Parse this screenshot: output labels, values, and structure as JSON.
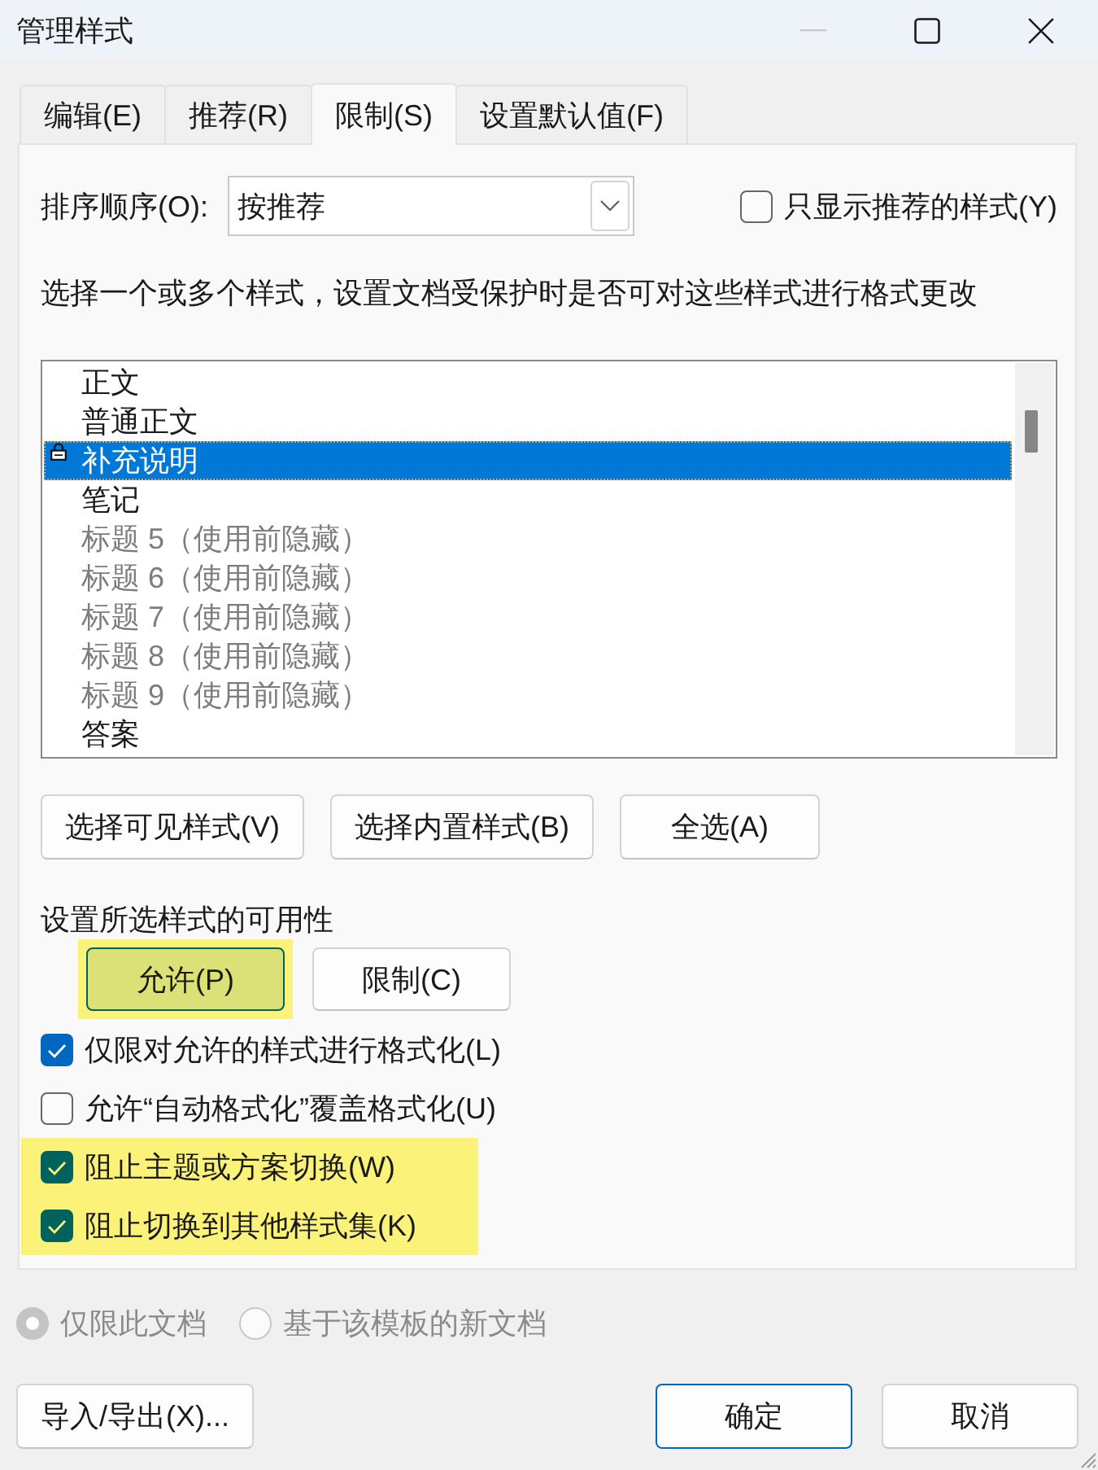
{
  "window": {
    "title": "管理样式",
    "minimize_disabled": true
  },
  "tabs": [
    {
      "label": "编辑(E)",
      "selected": false
    },
    {
      "label": "推荐(R)",
      "selected": false
    },
    {
      "label": "限制(S)",
      "selected": true
    },
    {
      "label": "设置默认值(F)",
      "selected": false
    }
  ],
  "sort": {
    "label": "排序顺序(O):",
    "value": "按推荐",
    "recommended_only": {
      "label": "只显示推荐的样式(Y)",
      "checked": false
    }
  },
  "instructions": "选择一个或多个样式，设置文档受保护时是否可对这些样式进行格式更改",
  "styles": [
    {
      "name": "正文",
      "selected": false,
      "locked": false,
      "greyed": false
    },
    {
      "name": "普通正文",
      "selected": false,
      "locked": false,
      "greyed": false
    },
    {
      "name": "补充说明",
      "selected": true,
      "locked": true,
      "greyed": false
    },
    {
      "name": "笔记",
      "selected": false,
      "locked": false,
      "greyed": false
    },
    {
      "name": "标题 5（使用前隐藏）",
      "selected": false,
      "locked": false,
      "greyed": true
    },
    {
      "name": "标题 6（使用前隐藏）",
      "selected": false,
      "locked": false,
      "greyed": true
    },
    {
      "name": "标题 7（使用前隐藏）",
      "selected": false,
      "locked": false,
      "greyed": true
    },
    {
      "name": "标题 8（使用前隐藏）",
      "selected": false,
      "locked": false,
      "greyed": true
    },
    {
      "name": "标题 9（使用前隐藏）",
      "selected": false,
      "locked": false,
      "greyed": true
    },
    {
      "name": "答案",
      "selected": false,
      "locked": false,
      "greyed": false
    }
  ],
  "select_buttons": [
    "选择可见样式(V)",
    "选择内置样式(B)",
    "全选(A)"
  ],
  "availability": {
    "label": "设置所选样式的可用性",
    "buttons": [
      {
        "label": "允许(P)",
        "focused": true,
        "highlighted": true
      },
      {
        "label": "限制(C)",
        "focused": false,
        "highlighted": false
      }
    ]
  },
  "options": [
    {
      "label": "仅限对允许的样式进行格式化(L)",
      "checked": true,
      "highlighted": false
    },
    {
      "label": "允许“自动格式化”覆盖格式化(U)",
      "checked": false,
      "highlighted": false
    },
    {
      "label": "阻止主题或方案切换(W)",
      "checked": true,
      "highlighted": true
    },
    {
      "label": "阻止切换到其他样式集(K)",
      "checked": true,
      "highlighted": true
    }
  ],
  "scope": [
    {
      "label": "仅限此文档",
      "selected": true,
      "disabled": true
    },
    {
      "label": "基于该模板的新文档",
      "selected": false,
      "disabled": true
    }
  ],
  "footer_buttons": [
    {
      "label": "导入/导出(X)...",
      "default": false
    },
    {
      "label": "确定",
      "default": true
    },
    {
      "label": "取消",
      "default": false
    }
  ]
}
